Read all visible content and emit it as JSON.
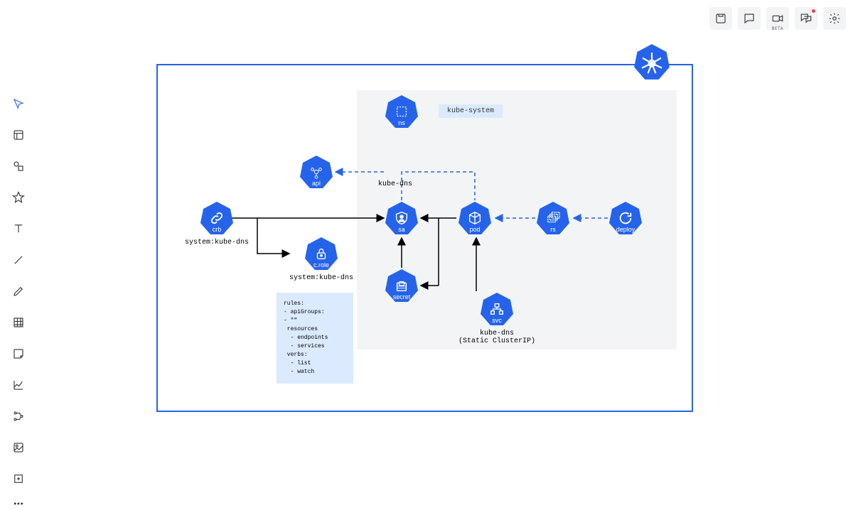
{
  "topbar": {
    "beta_label": "BETA"
  },
  "namespace": {
    "label": "kube-system"
  },
  "nodes": {
    "ns": {
      "label": "ns"
    },
    "api": {
      "label": "api"
    },
    "crb": {
      "label": "crb",
      "caption": "system:kube-dns"
    },
    "crole": {
      "label": "c.role",
      "caption": "system:kube-dns"
    },
    "sa": {
      "label": "sa",
      "caption": "kube-dns"
    },
    "pod": {
      "label": "pod"
    },
    "rs": {
      "label": "rs"
    },
    "deploy": {
      "label": "deploy"
    },
    "secret": {
      "label": "secret"
    },
    "svc": {
      "label": "svc",
      "caption": "kube-dns\n(Static ClusterIP)"
    }
  },
  "rules_box": "rules:\n- apiGroups:\n- \"\"\n resources\n  - endpoints\n  - services\n verbs:\n  - list\n  - watch",
  "colors": {
    "primary": "#2563eb",
    "light_blue": "#dbeafe",
    "gray_bg": "#f3f4f6"
  }
}
